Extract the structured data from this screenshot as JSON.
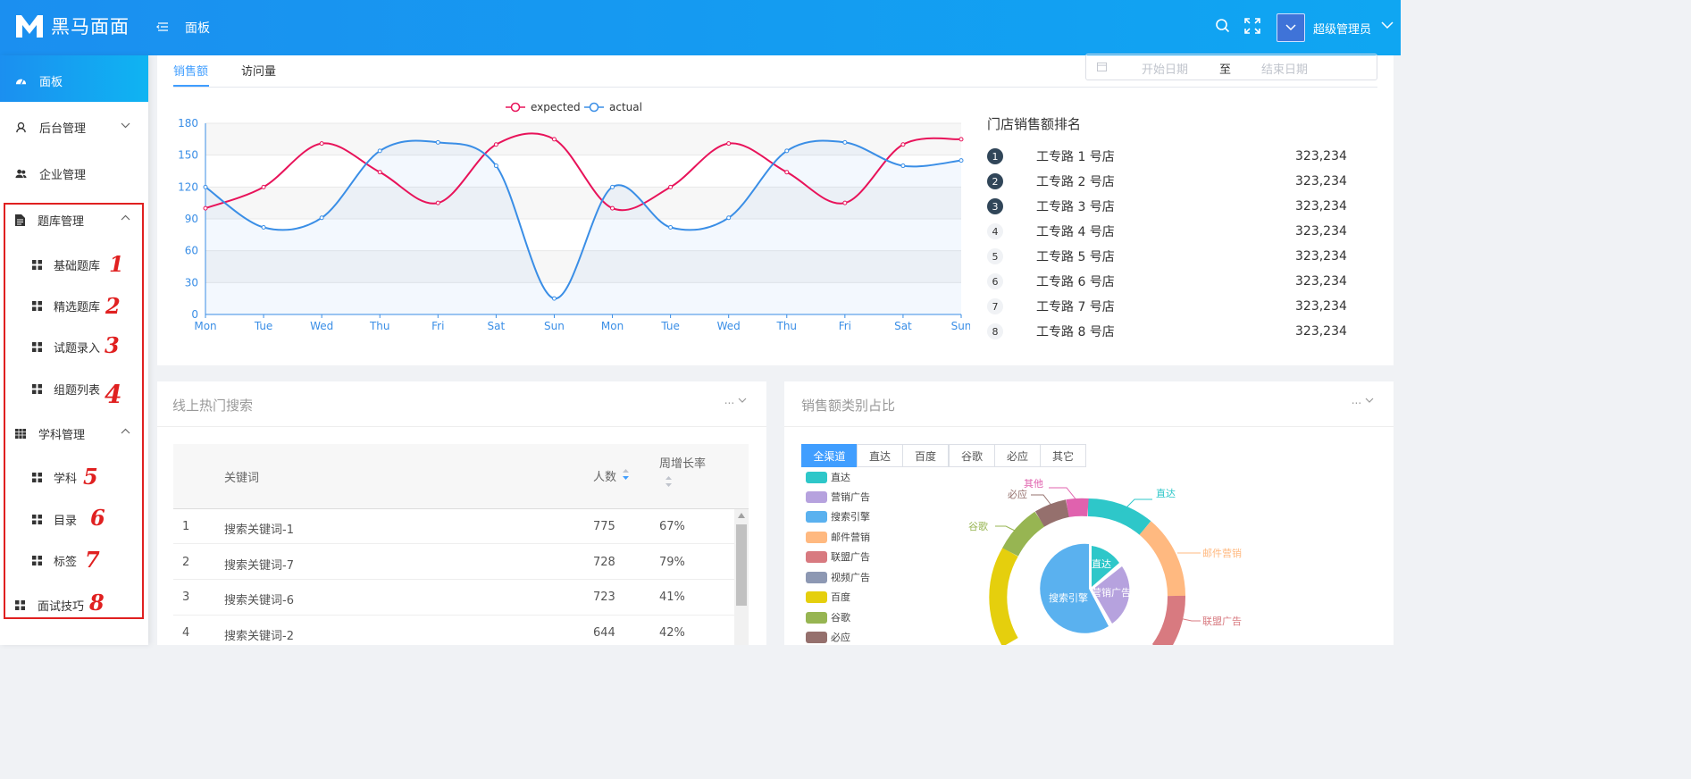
{
  "header": {
    "logo_text": "黑马面面",
    "title": "面板",
    "username": "超级管理员",
    "brand_color": "#1b8ff0"
  },
  "sidebar": {
    "items": [
      {
        "label": "面板",
        "icon": "dashboard-icon",
        "active": true
      },
      {
        "label": "后台管理",
        "icon": "user-tie-icon"
      },
      {
        "label": "企业管理",
        "icon": "users-icon"
      },
      {
        "label": "题库管理",
        "icon": "document-icon",
        "expanded": true
      },
      {
        "label": "基础题库",
        "icon": "grid-icon",
        "annotation": "1"
      },
      {
        "label": "精选题库",
        "icon": "grid-icon",
        "annotation": "2"
      },
      {
        "label": "试题录入",
        "icon": "grid-icon",
        "annotation": "3"
      },
      {
        "label": "组题列表",
        "icon": "grid-icon",
        "annotation": "4"
      },
      {
        "label": "学科管理",
        "icon": "table-icon",
        "expanded": true
      },
      {
        "label": "学科",
        "icon": "grid-icon",
        "annotation": "5"
      },
      {
        "label": "目录",
        "icon": "grid-icon",
        "annotation": "6"
      },
      {
        "label": "标签",
        "icon": "grid-icon",
        "annotation": "7"
      },
      {
        "label": "面试技巧",
        "icon": "grid-icon",
        "annotation": "8"
      }
    ]
  },
  "sales": {
    "tabs": [
      "销售额",
      "访问量"
    ],
    "active_tab": 0,
    "date_start_placeholder": "开始日期",
    "date_sep": "至",
    "date_end_placeholder": "结束日期",
    "rank_title": "门店销售额排名",
    "rank": [
      {
        "no": "1",
        "name": "工专路 1 号店",
        "value": "323,234"
      },
      {
        "no": "2",
        "name": "工专路 2 号店",
        "value": "323,234"
      },
      {
        "no": "3",
        "name": "工专路 3 号店",
        "value": "323,234"
      },
      {
        "no": "4",
        "name": "工专路 4 号店",
        "value": "323,234"
      },
      {
        "no": "5",
        "name": "工专路 5 号店",
        "value": "323,234"
      },
      {
        "no": "6",
        "name": "工专路 6 号店",
        "value": "323,234"
      },
      {
        "no": "7",
        "name": "工专路 7 号店",
        "value": "323,234"
      },
      {
        "no": "8",
        "name": "工专路 8 号店",
        "value": "323,234"
      }
    ]
  },
  "hot_search": {
    "title": "线上热门搜索",
    "more": "...",
    "columns": [
      "关键词",
      "人数",
      "周增长率"
    ],
    "rows": [
      {
        "rank": "1",
        "keyword": "搜索关键词-1",
        "count": "775",
        "rate": "67%"
      },
      {
        "rank": "2",
        "keyword": "搜索关键词-7",
        "count": "728",
        "rate": "79%"
      },
      {
        "rank": "3",
        "keyword": "搜索关键词-6",
        "count": "723",
        "rate": "41%"
      },
      {
        "rank": "4",
        "keyword": "搜索关键词-2",
        "count": "644",
        "rate": "42%"
      }
    ]
  },
  "category": {
    "title": "销售额类别占比",
    "more": "...",
    "channels": [
      "全渠道",
      "直达",
      "百度",
      "谷歌",
      "必应",
      "其它"
    ],
    "active_channel": 0,
    "legend": [
      {
        "name": "直达",
        "color": "#2ec7c9"
      },
      {
        "name": "营销广告",
        "color": "#b6a2de"
      },
      {
        "name": "搜索引擎",
        "color": "#5ab1ef"
      },
      {
        "name": "邮件营销",
        "color": "#ffb980"
      },
      {
        "name": "联盟广告",
        "color": "#d87a80"
      },
      {
        "name": "视频广告",
        "color": "#8d98b3"
      },
      {
        "name": "百度",
        "color": "#e5cf0d"
      },
      {
        "name": "谷歌",
        "color": "#97b552"
      },
      {
        "name": "必应",
        "color": "#95706d"
      }
    ],
    "outer_labels": [
      "直达",
      "邮件营销",
      "联盟广告",
      "谷歌",
      "必应",
      "其他"
    ],
    "inner_labels": [
      "直达",
      "营销广告",
      "搜索引擎"
    ]
  },
  "chart_data": {
    "type": "line",
    "categories": [
      "Mon",
      "Tue",
      "Wed",
      "Thu",
      "Fri",
      "Sat",
      "Sun",
      "Mon",
      "Tue",
      "Wed",
      "Thu",
      "Fri",
      "Sat",
      "Sun"
    ],
    "series": [
      {
        "name": "expected",
        "color": "#e8135a",
        "values": [
          100,
          120,
          161,
          134,
          105,
          160,
          165,
          100,
          120,
          161,
          134,
          105,
          160,
          165
        ]
      },
      {
        "name": "actual",
        "color": "#3a8ee6",
        "values": [
          120,
          82,
          91,
          154,
          162,
          140,
          15,
          120,
          82,
          91,
          154,
          162,
          140,
          145
        ]
      }
    ],
    "ylim": [
      0,
      180
    ],
    "yticks": [
      0,
      30,
      60,
      90,
      120,
      150,
      180
    ],
    "legend": "top-center",
    "grid": true
  }
}
